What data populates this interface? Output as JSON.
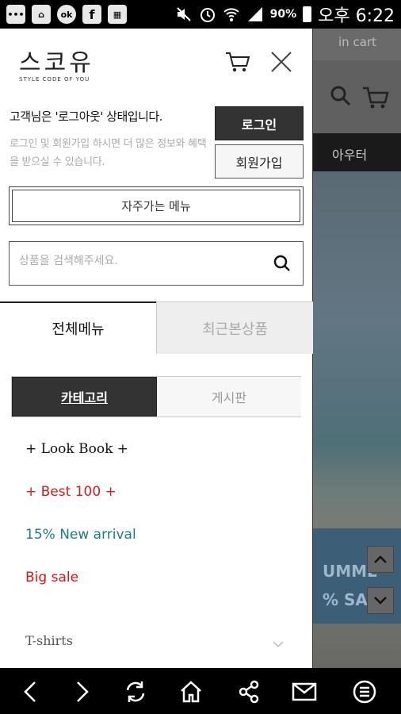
{
  "statusbar": {
    "battery": "90%",
    "time": "오후 6:22",
    "left_icons": [
      "chat-icon",
      "store-icon",
      "badge-icon",
      "facebook-icon",
      "app-icon"
    ],
    "right_icons": [
      "mute-icon",
      "alarm-icon",
      "wifi-icon",
      "signal-icon",
      "battery-icon"
    ]
  },
  "background_page": {
    "top_label": "in cart",
    "nav_label": "아우터",
    "banner_text_1": "UMME",
    "banner_text_2": "% SAL"
  },
  "drawer": {
    "logo_text": "스코유",
    "logo_sub": "STYLE CODE OF YOU",
    "status_message": "고객님은 '로그아웃' 상태입니다.",
    "status_sub": "로그인 및 회원가입 하시면 더 많은 정보와 혜택을 받으실 수 있습니다.",
    "login_label": "로그인",
    "join_label": "회원가입",
    "frequent_menu_label": "자주가는 메뉴",
    "search_placeholder": "상품을 검색해주세요.",
    "tabs": {
      "all": "전체메뉴",
      "recent": "최근본상품"
    },
    "segments": {
      "category": "카테고리",
      "board": "게시판"
    },
    "menu": {
      "lookbook": "+ Look Book +",
      "best": "+ Best 100 +",
      "new_arrival": "15% New arrival",
      "big_sale": "Big sale",
      "tshirts": "T-shirts"
    },
    "colors": {
      "best": "#d31b1b",
      "new_arrival": "#1b7b87",
      "big_sale": "#e01414",
      "active": "#333333"
    }
  },
  "bottom_nav": {
    "icons": [
      "back-icon",
      "forward-icon",
      "refresh-icon",
      "home-icon",
      "share-icon",
      "mail-icon",
      "menu-icon"
    ]
  }
}
